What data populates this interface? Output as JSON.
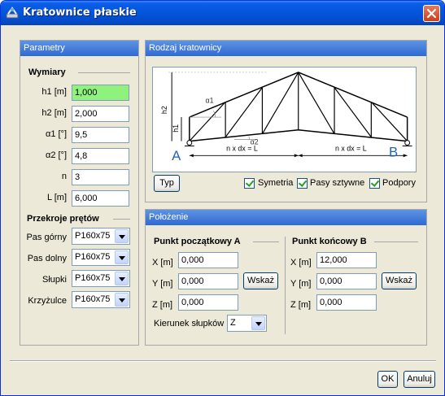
{
  "window": {
    "title": "Kratownice płaskie"
  },
  "parametry": {
    "header": "Parametry",
    "wymiary_title": "Wymiary",
    "fields": [
      {
        "label": "h1 [m]",
        "value": "1,000"
      },
      {
        "label": "h2 [m]",
        "value": "2,000"
      },
      {
        "label": "α1 [°]",
        "value": "9,5"
      },
      {
        "label": "α2 [°]",
        "value": "4,8"
      },
      {
        "label": "n",
        "value": "3"
      },
      {
        "label": "L [m]",
        "value": "6,000"
      }
    ],
    "przekroje_title": "Przekroje prętów",
    "sections": [
      {
        "label": "Pas górny",
        "value": "P160x75"
      },
      {
        "label": "Pas dolny",
        "value": "P160x75"
      },
      {
        "label": "Słupki",
        "value": "P160x75"
      },
      {
        "label": "Krzyżulce",
        "value": "P160x75"
      }
    ]
  },
  "rodzaj": {
    "header": "Rodzaj kratownicy",
    "typ_button": "Typ",
    "diagram": {
      "label_a": "A",
      "label_b": "B",
      "h1": "h1",
      "h2": "h2",
      "alpha1": "α1",
      "alpha2": "α2",
      "span_left": "n x dx = L",
      "span_right": "n x dx = L"
    },
    "checkboxes": [
      {
        "label": "Symetria",
        "checked": true
      },
      {
        "label": "Pasy sztywne",
        "checked": true
      },
      {
        "label": "Podpory",
        "checked": true
      }
    ]
  },
  "polozenie": {
    "header": "Położenie",
    "start_title": "Punkt początkowy A",
    "end_title": "Punkt końcowy B",
    "start": [
      {
        "label": "X [m]",
        "value": "0,000"
      },
      {
        "label": "Y [m]",
        "value": "0,000"
      },
      {
        "label": "Z [m]",
        "value": "0,000"
      }
    ],
    "end": [
      {
        "label": "X [m]",
        "value": "12,000"
      },
      {
        "label": "Y [m]",
        "value": "0,000"
      },
      {
        "label": "Z [m]",
        "value": "0,000"
      }
    ],
    "wskaz_label": "Wskaż",
    "kierunek_label": "Kierunek słupków",
    "kierunek_value": "Z"
  },
  "footer": {
    "ok_label": "OK",
    "cancel_label": "Anuluj"
  }
}
